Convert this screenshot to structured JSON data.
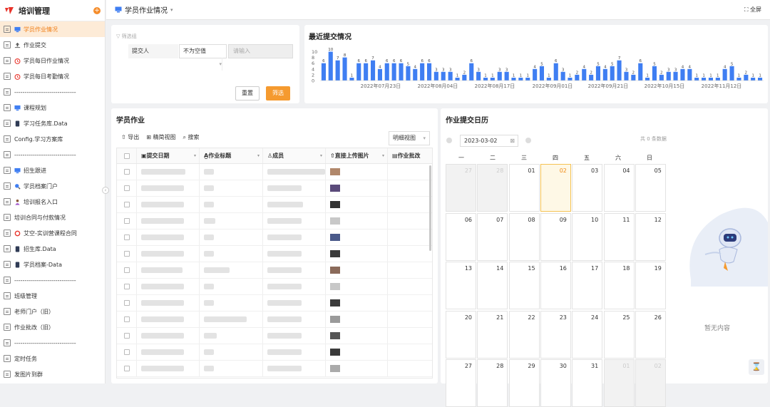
{
  "sidebar": {
    "title": "培训管理",
    "items": [
      {
        "label": "学员作业情况",
        "icon": "monitor-icon",
        "active": true
      },
      {
        "label": "作业提交",
        "icon": "upload-icon"
      },
      {
        "label": "学员每日作业情况",
        "icon": "clock-icon"
      },
      {
        "label": "学员每日考勤情况",
        "icon": "clock-icon"
      },
      {
        "label": "------------------------------",
        "icon": "page-icon"
      },
      {
        "label": "课程规划",
        "icon": "monitor-icon"
      },
      {
        "label": "学习任务库.Data",
        "icon": "phone-icon"
      },
      {
        "label": "Config.学习方案库",
        "icon": "page-icon"
      },
      {
        "label": "------------------------------",
        "icon": "page-icon"
      },
      {
        "label": "招生跟进",
        "icon": "monitor-icon"
      },
      {
        "label": "学员档案门户",
        "icon": "search-icon"
      },
      {
        "label": "培训报名入口",
        "icon": "person-icon"
      },
      {
        "label": "培训合同与付款情况",
        "icon": "page-icon"
      },
      {
        "label": "艾空-实训营课程合同",
        "icon": "circle-icon"
      },
      {
        "label": "招生库.Data",
        "icon": "phone-icon"
      },
      {
        "label": "学员档案-Data",
        "icon": "phone-icon"
      },
      {
        "label": "------------------------------",
        "icon": "page-icon"
      },
      {
        "label": "班级管理",
        "icon": "page-icon"
      },
      {
        "label": "老师门户（旧）",
        "icon": "page-icon"
      },
      {
        "label": "作业批改（旧）",
        "icon": "page-icon"
      },
      {
        "label": "------------------------------",
        "icon": "page-icon"
      },
      {
        "label": "定时任务",
        "icon": "page-icon"
      },
      {
        "label": "发图片到群",
        "icon": "page-icon"
      }
    ]
  },
  "header": {
    "title": "学员作业情况",
    "fullscreen": "全屏"
  },
  "filter": {
    "label": "筛选组",
    "field": "提交人",
    "operator": "不为空值",
    "value_placeholder": "请输入",
    "reset": "重置",
    "apply": "筛选"
  },
  "recent": {
    "title": "最近提交情况",
    "chart_data": {
      "type": "bar",
      "title": "最近提交情况",
      "ylim": [
        0,
        10
      ],
      "yticks": [
        "10",
        "8",
        "6",
        "4",
        "2",
        "0"
      ],
      "xticks": [
        "2022年07月23日",
        "2022年08月04日",
        "2022年08月17日",
        "2022年09月01日",
        "2022年09月21日",
        "2022年10月15日",
        "2022年11月12日"
      ],
      "values": [
        6,
        10,
        7,
        8,
        1,
        6,
        6,
        7,
        4,
        6,
        6,
        6,
        5,
        4,
        6,
        6,
        3,
        3,
        3,
        1,
        2,
        6,
        3,
        1,
        1,
        3,
        3,
        1,
        1,
        1,
        4,
        5,
        1,
        6,
        3,
        1,
        2,
        4,
        2,
        5,
        4,
        5,
        7,
        3,
        2,
        6,
        1,
        5,
        2,
        3,
        3,
        4,
        4,
        1,
        1,
        1,
        1,
        4,
        5,
        1,
        2,
        1,
        1
      ],
      "color": "#3f7ef2"
    }
  },
  "homework": {
    "title": "学员作业",
    "toolbar": {
      "export": "导出",
      "view_switch": "精简视图",
      "search": "搜索",
      "view": "明细视图"
    },
    "columns": [
      "提交日期",
      "作业标题",
      "成员",
      "直接上传图片",
      "作业批改"
    ],
    "row_count": 13
  },
  "calendar": {
    "title": "作业提交日历",
    "date": "2023-03-02",
    "count_text": "共 0 条数据",
    "weekdays": [
      "一",
      "二",
      "三",
      "四",
      "五",
      "六",
      "日"
    ],
    "weeks": [
      [
        "27",
        "28",
        "01",
        "02",
        "03",
        "04",
        "05"
      ],
      [
        "06",
        "07",
        "08",
        "09",
        "10",
        "11",
        "12"
      ],
      [
        "13",
        "14",
        "15",
        "16",
        "17",
        "18",
        "19"
      ],
      [
        "20",
        "21",
        "22",
        "23",
        "24",
        "25",
        "26"
      ],
      [
        "27",
        "28",
        "29",
        "30",
        "31",
        "01",
        "02"
      ]
    ],
    "empty_text": "暂无内容"
  },
  "colors": {
    "accent": "#f59a2f",
    "bar": "#3f7ef2",
    "active_bg": "#fdebd7"
  }
}
